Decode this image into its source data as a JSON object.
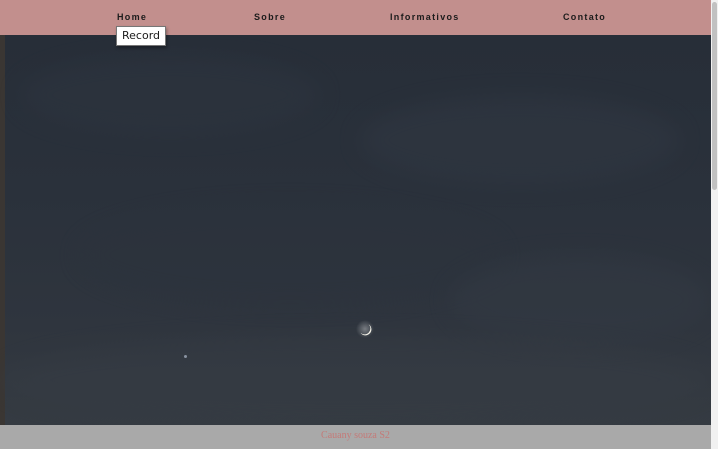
{
  "nav": {
    "items": [
      {
        "label": "Home"
      },
      {
        "label": "Sobre"
      },
      {
        "label": "Informativos"
      },
      {
        "label": "Contato"
      }
    ]
  },
  "tooltip": {
    "text": "Record"
  },
  "footer": {
    "text": "Cauany souza S2"
  },
  "colors": {
    "navbar": "#c28f8d",
    "footer_bg": "#a9a9a9",
    "footer_text": "#c47a78",
    "sky": "#2b323b"
  },
  "icons": {
    "moon": "crescent-moon",
    "star": "star"
  }
}
